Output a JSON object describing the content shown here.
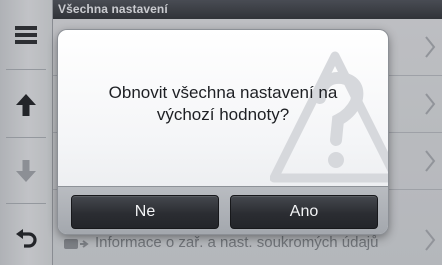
{
  "header": {
    "title": "Všechna nastavení"
  },
  "sidebar": {
    "items": [
      {
        "icon": "menu-icon"
      },
      {
        "icon": "arrow-up-icon"
      },
      {
        "icon": "arrow-down-icon"
      },
      {
        "icon": "back-icon"
      }
    ]
  },
  "list": {
    "last_row_label": "Informace o zař. a nast. soukromých údajů",
    "chevron_icon": "chevron-right-icon"
  },
  "dialog": {
    "message": "Obnovit všechna nastavení na výchozí hodnoty?",
    "watermark_icon": "warning-triangle-icon",
    "no_label": "Ne",
    "yes_label": "Ano"
  },
  "colors": {
    "header_bg": "#2e3137",
    "dialog_bg": "#f4f5f7",
    "button_bg": "#2b2d32",
    "button_text": "#f2f3f5"
  }
}
